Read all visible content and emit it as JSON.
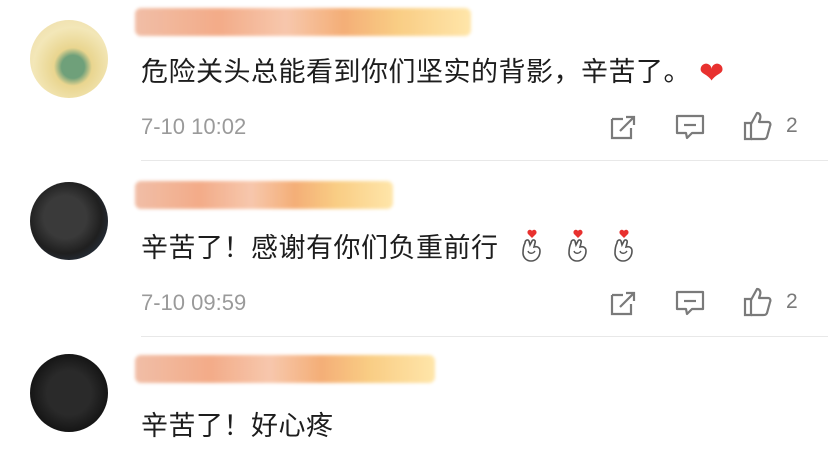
{
  "comments": [
    {
      "text": "危险关头总能看到你们坚实的背影，辛苦了。",
      "emoji": "❤",
      "time": "7-10 10:02",
      "likes": "2",
      "avatar_icon": "user-avatar",
      "heart_color": "#e8312f"
    },
    {
      "text": "辛苦了！感谢有你们负重前行",
      "emoji_names": [
        "finger-heart-icon",
        "finger-heart-icon",
        "finger-heart-icon"
      ],
      "time": "7-10 09:59",
      "likes": "2",
      "avatar_icon": "user-avatar"
    },
    {
      "text": "辛苦了！好心疼",
      "avatar_icon": "user-avatar"
    }
  ],
  "icons": {
    "share": "share-icon",
    "reply": "reply-icon",
    "like": "thumbs-up-icon"
  },
  "colors": {
    "text": "#1d1d1d",
    "meta": "#9a9a9a",
    "icon": "#7a7a7a"
  }
}
